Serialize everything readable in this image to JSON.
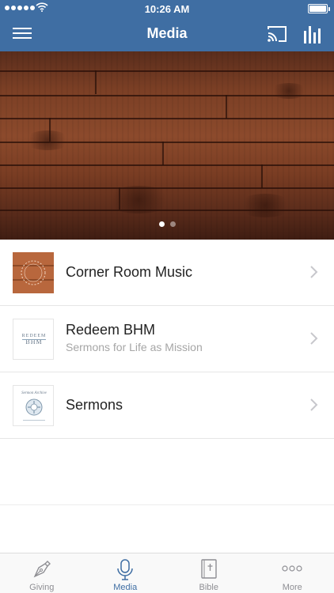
{
  "status_bar": {
    "time": "10:26 AM"
  },
  "header": {
    "title": "Media"
  },
  "hero": {
    "pages": 2,
    "active_page": 1
  },
  "media_list": [
    {
      "title": "Corner Room Music",
      "subtitle": "",
      "thumb_text": ""
    },
    {
      "title": "Redeem BHM",
      "subtitle": "Sermons for Life as Mission",
      "thumb_text": "REDEEM BHM"
    },
    {
      "title": "Sermons",
      "subtitle": "",
      "thumb_text": "Sermon Archive"
    }
  ],
  "tabs": [
    {
      "label": "Giving",
      "icon": "pen-icon",
      "active": false
    },
    {
      "label": "Media",
      "icon": "microphone-icon",
      "active": true
    },
    {
      "label": "Bible",
      "icon": "bible-icon",
      "active": false
    },
    {
      "label": "More",
      "icon": "ellipsis-icon",
      "active": false
    }
  ],
  "colors": {
    "accent": "#3f6ea3",
    "tab_inactive": "#8e8e93",
    "subtitle": "#a6a6a6"
  }
}
